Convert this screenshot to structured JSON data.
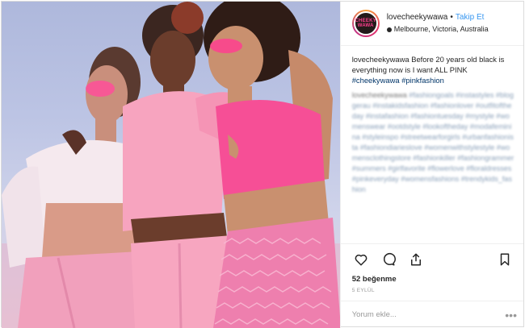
{
  "post": {
    "username": "lovecheekywawa",
    "follow_label": "Takip Et",
    "location": "Melbourne, Victoria, Australia",
    "avatar_text_line1": "CHEEKY",
    "avatar_text_line2": "WAWA",
    "caption_user": "lovecheekywawa",
    "caption_text": "Before 20 years old black is everything now is I want ALL PINK",
    "caption_tags": "#cheekywawa #pinkfashion",
    "comment_user": "lovecheekywawa",
    "comment_tags": "#fashiongoals #instastyles #bloggerau #instakidsfashion #fashionlover #outfitoftheday #instafashion #fashiontuesday #mystyle #womenswear #ootdstyle #lookoftheday #modafeminina #styleinspo #streetwearforgirls #urbanfashionista #fashiondiarieslove #womenwithstylestyle #womensclothingstore #fashionkiller #fashiongrammer #summers #girlfavorite #flowerlove #floraldresses #pinkeveryday #womensfashions #trendykids_fashion",
    "likes": "52 beğenme",
    "date": "5 Eylül",
    "comment_placeholder": "Yorum ekle...",
    "more_label": "•••"
  },
  "icons": {
    "like": "heart-icon",
    "comment": "comment-icon",
    "share": "share-icon",
    "save": "bookmark-icon",
    "location": "location-pin-icon"
  },
  "colors": {
    "link": "#3897f0",
    "hashtag": "#003569",
    "text": "#262626",
    "muted": "#999999",
    "border": "#dbdbdb"
  }
}
